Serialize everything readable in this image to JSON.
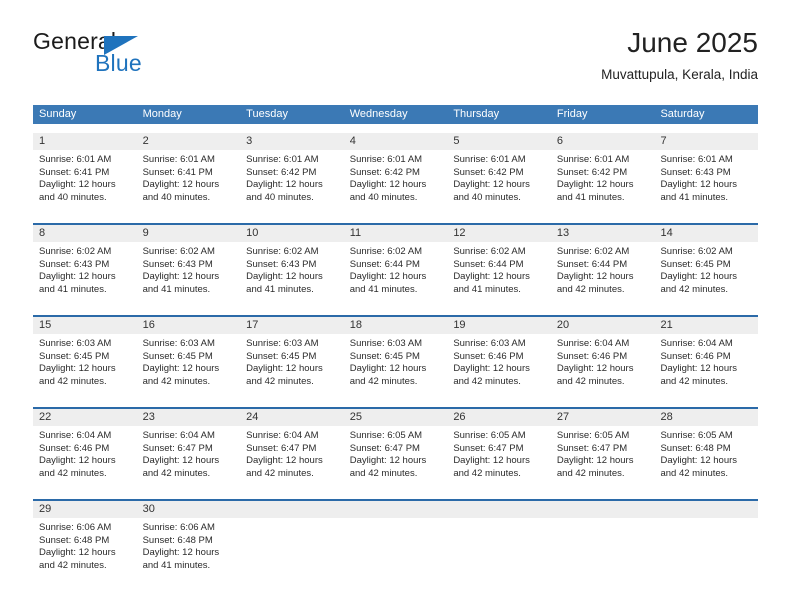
{
  "brand": {
    "name_primary": "General",
    "name_secondary": "Blue",
    "triangle_icon": "triangle-icon",
    "accent_color": "#1f73bd"
  },
  "header": {
    "title": "June 2025",
    "subtitle": "Muvattupula, Kerala, India"
  },
  "colors": {
    "header_blue": "#3b79b5",
    "separator_blue": "#2b6aa8",
    "daynum_band": "#eeeeee",
    "text": "#2b2b2b"
  },
  "weekdays": [
    "Sunday",
    "Monday",
    "Tuesday",
    "Wednesday",
    "Thursday",
    "Friday",
    "Saturday"
  ],
  "weeks": [
    {
      "days": [
        {
          "num": "1",
          "sunrise": "Sunrise: 6:01 AM",
          "sunset": "Sunset: 6:41 PM",
          "daylight": "Daylight: 12 hours and 40 minutes."
        },
        {
          "num": "2",
          "sunrise": "Sunrise: 6:01 AM",
          "sunset": "Sunset: 6:41 PM",
          "daylight": "Daylight: 12 hours and 40 minutes."
        },
        {
          "num": "3",
          "sunrise": "Sunrise: 6:01 AM",
          "sunset": "Sunset: 6:42 PM",
          "daylight": "Daylight: 12 hours and 40 minutes."
        },
        {
          "num": "4",
          "sunrise": "Sunrise: 6:01 AM",
          "sunset": "Sunset: 6:42 PM",
          "daylight": "Daylight: 12 hours and 40 minutes."
        },
        {
          "num": "5",
          "sunrise": "Sunrise: 6:01 AM",
          "sunset": "Sunset: 6:42 PM",
          "daylight": "Daylight: 12 hours and 40 minutes."
        },
        {
          "num": "6",
          "sunrise": "Sunrise: 6:01 AM",
          "sunset": "Sunset: 6:42 PM",
          "daylight": "Daylight: 12 hours and 41 minutes."
        },
        {
          "num": "7",
          "sunrise": "Sunrise: 6:01 AM",
          "sunset": "Sunset: 6:43 PM",
          "daylight": "Daylight: 12 hours and 41 minutes."
        }
      ]
    },
    {
      "days": [
        {
          "num": "8",
          "sunrise": "Sunrise: 6:02 AM",
          "sunset": "Sunset: 6:43 PM",
          "daylight": "Daylight: 12 hours and 41 minutes."
        },
        {
          "num": "9",
          "sunrise": "Sunrise: 6:02 AM",
          "sunset": "Sunset: 6:43 PM",
          "daylight": "Daylight: 12 hours and 41 minutes."
        },
        {
          "num": "10",
          "sunrise": "Sunrise: 6:02 AM",
          "sunset": "Sunset: 6:43 PM",
          "daylight": "Daylight: 12 hours and 41 minutes."
        },
        {
          "num": "11",
          "sunrise": "Sunrise: 6:02 AM",
          "sunset": "Sunset: 6:44 PM",
          "daylight": "Daylight: 12 hours and 41 minutes."
        },
        {
          "num": "12",
          "sunrise": "Sunrise: 6:02 AM",
          "sunset": "Sunset: 6:44 PM",
          "daylight": "Daylight: 12 hours and 41 minutes."
        },
        {
          "num": "13",
          "sunrise": "Sunrise: 6:02 AM",
          "sunset": "Sunset: 6:44 PM",
          "daylight": "Daylight: 12 hours and 42 minutes."
        },
        {
          "num": "14",
          "sunrise": "Sunrise: 6:02 AM",
          "sunset": "Sunset: 6:45 PM",
          "daylight": "Daylight: 12 hours and 42 minutes."
        }
      ]
    },
    {
      "days": [
        {
          "num": "15",
          "sunrise": "Sunrise: 6:03 AM",
          "sunset": "Sunset: 6:45 PM",
          "daylight": "Daylight: 12 hours and 42 minutes."
        },
        {
          "num": "16",
          "sunrise": "Sunrise: 6:03 AM",
          "sunset": "Sunset: 6:45 PM",
          "daylight": "Daylight: 12 hours and 42 minutes."
        },
        {
          "num": "17",
          "sunrise": "Sunrise: 6:03 AM",
          "sunset": "Sunset: 6:45 PM",
          "daylight": "Daylight: 12 hours and 42 minutes."
        },
        {
          "num": "18",
          "sunrise": "Sunrise: 6:03 AM",
          "sunset": "Sunset: 6:45 PM",
          "daylight": "Daylight: 12 hours and 42 minutes."
        },
        {
          "num": "19",
          "sunrise": "Sunrise: 6:03 AM",
          "sunset": "Sunset: 6:46 PM",
          "daylight": "Daylight: 12 hours and 42 minutes."
        },
        {
          "num": "20",
          "sunrise": "Sunrise: 6:04 AM",
          "sunset": "Sunset: 6:46 PM",
          "daylight": "Daylight: 12 hours and 42 minutes."
        },
        {
          "num": "21",
          "sunrise": "Sunrise: 6:04 AM",
          "sunset": "Sunset: 6:46 PM",
          "daylight": "Daylight: 12 hours and 42 minutes."
        }
      ]
    },
    {
      "days": [
        {
          "num": "22",
          "sunrise": "Sunrise: 6:04 AM",
          "sunset": "Sunset: 6:46 PM",
          "daylight": "Daylight: 12 hours and 42 minutes."
        },
        {
          "num": "23",
          "sunrise": "Sunrise: 6:04 AM",
          "sunset": "Sunset: 6:47 PM",
          "daylight": "Daylight: 12 hours and 42 minutes."
        },
        {
          "num": "24",
          "sunrise": "Sunrise: 6:04 AM",
          "sunset": "Sunset: 6:47 PM",
          "daylight": "Daylight: 12 hours and 42 minutes."
        },
        {
          "num": "25",
          "sunrise": "Sunrise: 6:05 AM",
          "sunset": "Sunset: 6:47 PM",
          "daylight": "Daylight: 12 hours and 42 minutes."
        },
        {
          "num": "26",
          "sunrise": "Sunrise: 6:05 AM",
          "sunset": "Sunset: 6:47 PM",
          "daylight": "Daylight: 12 hours and 42 minutes."
        },
        {
          "num": "27",
          "sunrise": "Sunrise: 6:05 AM",
          "sunset": "Sunset: 6:47 PM",
          "daylight": "Daylight: 12 hours and 42 minutes."
        },
        {
          "num": "28",
          "sunrise": "Sunrise: 6:05 AM",
          "sunset": "Sunset: 6:48 PM",
          "daylight": "Daylight: 12 hours and 42 minutes."
        }
      ]
    },
    {
      "days": [
        {
          "num": "29",
          "sunrise": "Sunrise: 6:06 AM",
          "sunset": "Sunset: 6:48 PM",
          "daylight": "Daylight: 12 hours and 42 minutes."
        },
        {
          "num": "30",
          "sunrise": "Sunrise: 6:06 AM",
          "sunset": "Sunset: 6:48 PM",
          "daylight": "Daylight: 12 hours and 41 minutes."
        },
        {
          "num": "",
          "sunrise": "",
          "sunset": "",
          "daylight": ""
        },
        {
          "num": "",
          "sunrise": "",
          "sunset": "",
          "daylight": ""
        },
        {
          "num": "",
          "sunrise": "",
          "sunset": "",
          "daylight": ""
        },
        {
          "num": "",
          "sunrise": "",
          "sunset": "",
          "daylight": ""
        },
        {
          "num": "",
          "sunrise": "",
          "sunset": "",
          "daylight": ""
        }
      ]
    }
  ]
}
